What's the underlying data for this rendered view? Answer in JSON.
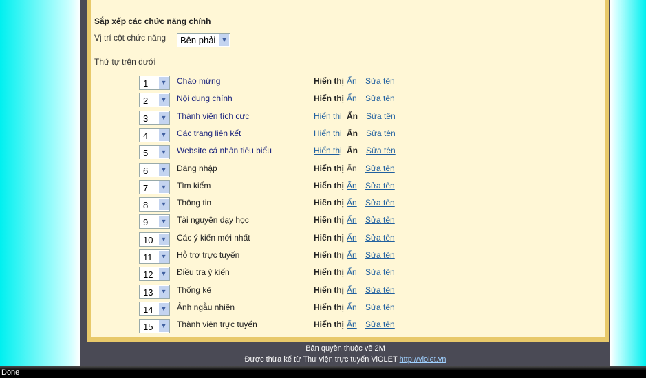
{
  "section_title": "Sắp xếp các chức năng chính",
  "position_label": "Vị trí cột chức năng",
  "position_value": "Bên phải",
  "order_label": "Thứ tự trên dưới",
  "show_label": "Hiển thị",
  "hide_label": "Ẩn",
  "rename_label": "Sửa tên",
  "rows": [
    {
      "order": "1",
      "name": "Chào mừng",
      "visible": true,
      "highlight": true
    },
    {
      "order": "2",
      "name": "Nội dung chính",
      "visible": true,
      "highlight": true
    },
    {
      "order": "3",
      "name": "Thành viên tích cực",
      "visible": false,
      "highlight": true
    },
    {
      "order": "4",
      "name": "Các trang liên kết",
      "visible": false,
      "highlight": true
    },
    {
      "order": "5",
      "name": "Website cá nhân tiêu biểu",
      "visible": false,
      "highlight": true
    },
    {
      "order": "6",
      "name": "Đăng nhập",
      "visible": true,
      "hide_disabled": true
    },
    {
      "order": "7",
      "name": "Tìm kiếm",
      "visible": true
    },
    {
      "order": "8",
      "name": "Thông tin",
      "visible": true
    },
    {
      "order": "9",
      "name": "Tài nguyên dạy học",
      "visible": true
    },
    {
      "order": "10",
      "name": "Các ý kiến mới nhất",
      "visible": true
    },
    {
      "order": "11",
      "name": "Hỗ trợ trực tuyến",
      "visible": true
    },
    {
      "order": "12",
      "name": "Điều tra ý kiến",
      "visible": true
    },
    {
      "order": "13",
      "name": "Thống kê",
      "visible": true
    },
    {
      "order": "14",
      "name": "Ảnh ngẫu nhiên",
      "visible": true
    },
    {
      "order": "15",
      "name": "Thành viên trực tuyến",
      "visible": true
    }
  ],
  "footer": {
    "copyright": "Bản quyền thuộc về 2M",
    "inherit": "Được thừa kế từ Thư viện trực tuyến ViOLET",
    "link": "http://violet.vn"
  },
  "status": "Done"
}
